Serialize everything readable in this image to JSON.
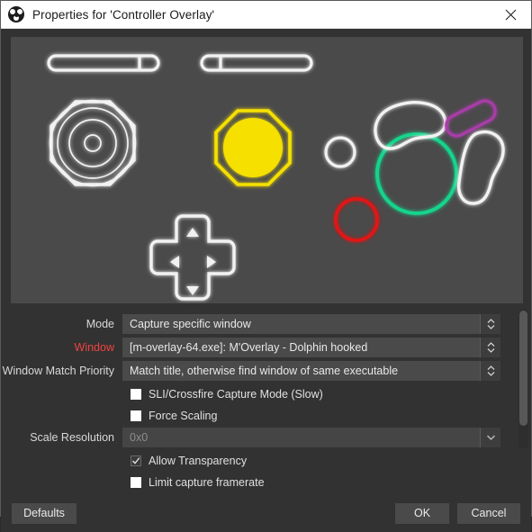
{
  "titlebar": {
    "icon": "obs-logo-icon",
    "title": "Properties for 'Controller Overlay'",
    "close_label": "✕"
  },
  "preview": {
    "background_color": "#4a4a4a",
    "description": "GameCube controller overlay capture preview",
    "elements": [
      {
        "name": "l-trigger",
        "color": "#f2f2f2"
      },
      {
        "name": "r-trigger",
        "color": "#f2f2f2"
      },
      {
        "name": "analog-stick",
        "color": "#f2f2f2"
      },
      {
        "name": "c-stick",
        "color": "#f5e000"
      },
      {
        "name": "d-pad",
        "color": "#f2f2f2"
      },
      {
        "name": "start-button",
        "color": "#f2f2f2"
      },
      {
        "name": "a-button",
        "color": "#14d48c"
      },
      {
        "name": "b-button",
        "color": "#e01212"
      },
      {
        "name": "y-button",
        "color": "#f2f2f2"
      },
      {
        "name": "x-button",
        "color": "#f2f2f2"
      },
      {
        "name": "z-button",
        "color": "#a83ca8"
      }
    ]
  },
  "form": {
    "mode": {
      "label": "Mode",
      "value": "Capture specific window"
    },
    "window": {
      "label": "Window",
      "value": "[m-overlay-64.exe]: M'Overlay - Dolphin hooked",
      "label_color": "#f04242"
    },
    "match_priority": {
      "label": "Window Match Priority",
      "value": "Match title, otherwise find window of same executable"
    },
    "sli_crossfire": {
      "label": "SLI/Crossfire Capture Mode (Slow)",
      "checked": false
    },
    "force_scaling": {
      "label": "Force Scaling",
      "checked": false
    },
    "scale_resolution": {
      "label": "Scale Resolution",
      "value": "0x0",
      "disabled": true
    },
    "allow_transparency": {
      "label": "Allow Transparency",
      "checked": true
    },
    "limit_framerate": {
      "label": "Limit capture framerate",
      "checked": false
    }
  },
  "footer": {
    "defaults_label": "Defaults",
    "ok_label": "OK",
    "cancel_label": "Cancel"
  }
}
